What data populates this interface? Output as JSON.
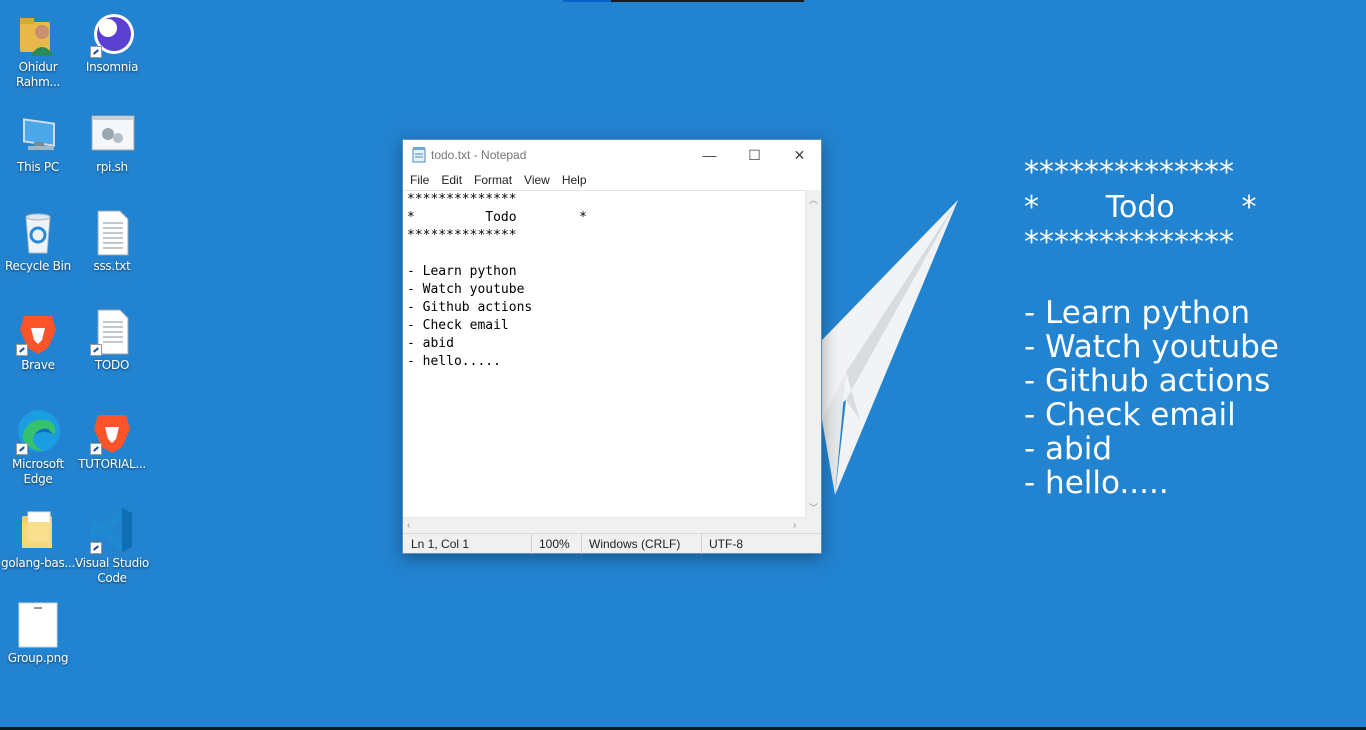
{
  "desktop": {
    "background_color": "#2283d1",
    "icons": [
      {
        "label": "Ohidur Rahm...",
        "icon": "user-folder-icon"
      },
      {
        "label": "Insomnia",
        "icon": "insomnia-icon"
      },
      {
        "label": "This PC",
        "icon": "computer-icon"
      },
      {
        "label": "rpi.sh",
        "icon": "shell-script-icon"
      },
      {
        "label": "Recycle Bin",
        "icon": "recycle-bin-icon"
      },
      {
        "label": "sss.txt",
        "icon": "text-file-icon"
      },
      {
        "label": "Brave",
        "icon": "brave-icon"
      },
      {
        "label": "TODO",
        "icon": "text-file-icon"
      },
      {
        "label": "Microsoft Edge",
        "icon": "edge-icon"
      },
      {
        "label": "TUTORIAL...",
        "icon": "brave-icon"
      },
      {
        "label": "golang-bas...",
        "icon": "folder-icon"
      },
      {
        "label": "Visual Studio Code",
        "icon": "vscode-icon"
      },
      {
        "label": "Group.png",
        "icon": "image-file-icon"
      }
    ]
  },
  "wallpaper_text": {
    "stars_top": "**************",
    "title_line": "*       Todo       *",
    "stars_bottom": "**************",
    "items": [
      "- Learn python",
      "- Watch youtube",
      "- Github actions",
      "- Check email",
      "- abid",
      "- hello....."
    ]
  },
  "notepad": {
    "title": "todo.txt - Notepad",
    "menu": [
      "File",
      "Edit",
      "Format",
      "View",
      "Help"
    ],
    "content": "**************\n*         Todo        *\n**************\n\n- Learn python\n- Watch youtube\n- Github actions\n- Check email\n- abid\n- hello.....",
    "status": {
      "position": "Ln 1, Col 1",
      "zoom": "100%",
      "line_ending": "Windows (CRLF)",
      "encoding": "UTF-8"
    },
    "window_buttons": {
      "minimize": "—",
      "maximize": "☐",
      "close": "✕"
    }
  }
}
